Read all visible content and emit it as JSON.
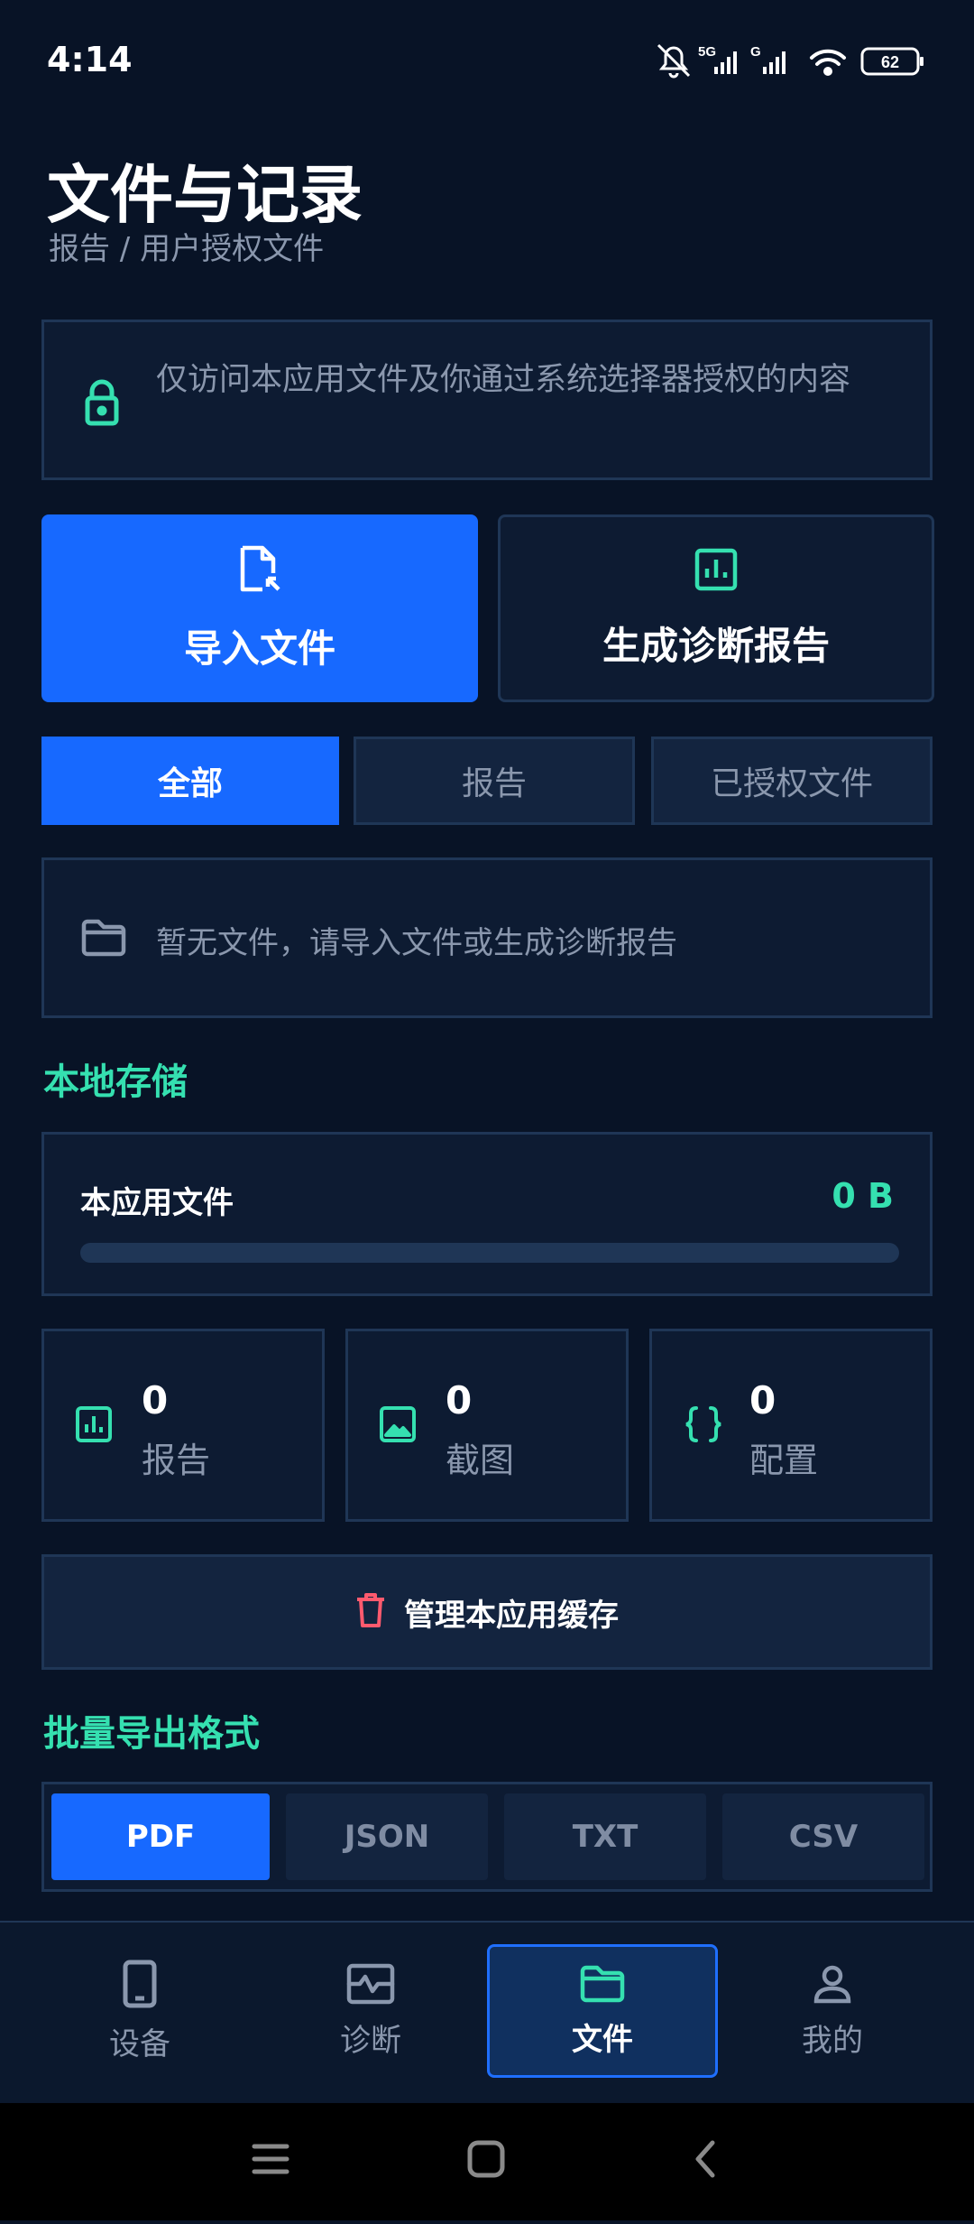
{
  "status_bar": {
    "time": "4:14",
    "battery": "62",
    "network_5g": "5G",
    "network_g": "G"
  },
  "header": {
    "title": "文件与记录",
    "breadcrumb": "报告 / 用户授权文件"
  },
  "notice": {
    "icon": "lock-icon",
    "text": "仅访问本应用文件及你通过系统选择器授权的内容"
  },
  "actions": {
    "import_label": "导入文件",
    "report_label": "生成诊断报告"
  },
  "filter_tabs": [
    {
      "label": "全部",
      "active": true
    },
    {
      "label": "报告",
      "active": false
    },
    {
      "label": "已授权文件",
      "active": false
    }
  ],
  "empty_state": {
    "text": "暂无文件，请导入文件或生成诊断报告"
  },
  "local_storage": {
    "section_title": "本地存储",
    "label": "本应用文件",
    "value": "0 B",
    "usage_fraction": 0
  },
  "stats": [
    {
      "icon": "chart-icon",
      "count": "0",
      "label": "报告"
    },
    {
      "icon": "image-icon",
      "count": "0",
      "label": "截图"
    },
    {
      "icon": "braces-icon",
      "count": "0",
      "label": "配置"
    }
  ],
  "cache": {
    "label": "管理本应用缓存"
  },
  "export": {
    "section_title": "批量导出格式",
    "options": [
      {
        "label": "PDF",
        "active": true
      },
      {
        "label": "JSON",
        "active": false
      },
      {
        "label": "TXT",
        "active": false
      },
      {
        "label": "CSV",
        "active": false
      }
    ]
  },
  "bottom_nav": [
    {
      "label": "设备",
      "icon": "phone-icon",
      "active": false
    },
    {
      "label": "诊断",
      "icon": "pulse-icon",
      "active": false
    },
    {
      "label": "文件",
      "icon": "folder-icon",
      "active": true
    },
    {
      "label": "我的",
      "icon": "user-icon",
      "active": false
    }
  ],
  "colors": {
    "background": "#081326",
    "accent_blue": "#1769ff",
    "accent_teal": "#35e0b0",
    "danger": "#ff5a6e",
    "muted_text": "#8a97ad"
  }
}
